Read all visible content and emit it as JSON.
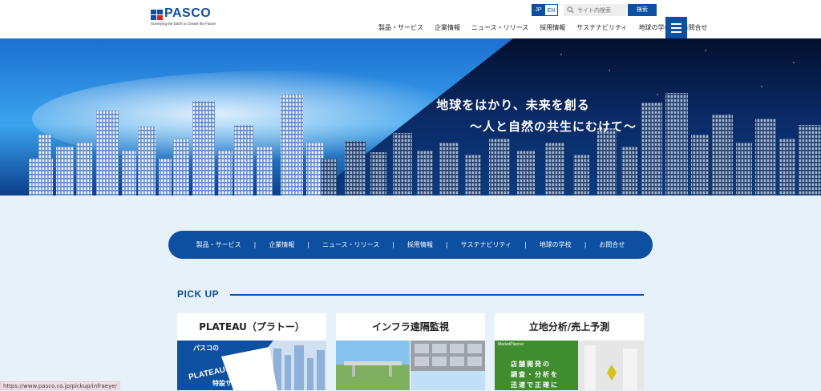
{
  "header": {
    "logo_text": "PASCO",
    "tagline": "Surveying the Earth to Create the Future",
    "lang_jp": "JP",
    "lang_en": "EN",
    "search_placeholder": "サイト内検索",
    "search_button": "検索",
    "nav": [
      "製品・サービス",
      "企業情報",
      "ニュース・リリース",
      "採用情報",
      "サステナビリティ",
      "地球の学校",
      "お問合せ"
    ]
  },
  "hero": {
    "line1": "地球をはかり、未来を創る",
    "line2": "〜人と自然の共生にむけて〜"
  },
  "subnav": {
    "items": [
      "製品・サービス",
      "企業情報",
      "ニュース・リリース",
      "採用情報",
      "サステナビリティ",
      "地球の学校",
      "お問合せ"
    ],
    "separator": "|"
  },
  "pickup": {
    "title": "PICK UP",
    "cards": [
      {
        "title": "PLATEAU（プラトー）",
        "banner_line1": "パスコの",
        "banner_line2": "PLATEAU",
        "banner_line3": "特設サイト"
      },
      {
        "title": "インフラ遠隔監視"
      },
      {
        "title": "立地分析/売上予測",
        "badge": "MarketPlanner",
        "lines": [
          "店舗開発の",
          "調査・分析を",
          "迅速で正確に"
        ]
      }
    ]
  },
  "status_bar": {
    "url": "https://www.pasco.co.jp/pickup/infraeye/"
  },
  "colors": {
    "brand_blue": "#0d4fa0",
    "page_bg": "#e6f1fa"
  }
}
